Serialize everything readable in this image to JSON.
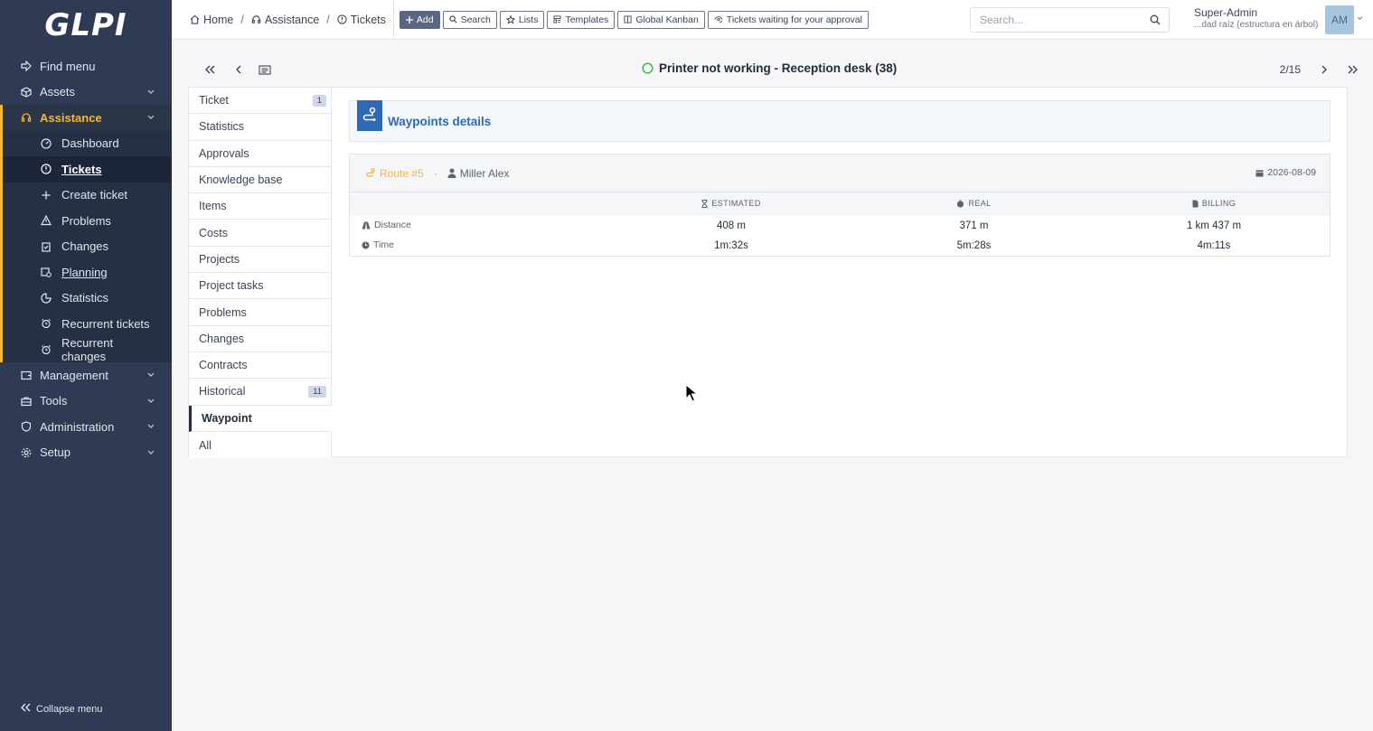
{
  "sidebar": {
    "logo": "GLPI",
    "items": [
      {
        "label": "Find menu",
        "icon": "arrow-right-icon"
      },
      {
        "label": "Assets",
        "icon": "box-icon"
      },
      {
        "label": "Assistance",
        "icon": "headset-icon"
      },
      {
        "label": "Management",
        "icon": "wallet-icon"
      },
      {
        "label": "Tools",
        "icon": "briefcase-icon"
      },
      {
        "label": "Administration",
        "icon": "shield-icon"
      },
      {
        "label": "Setup",
        "icon": "gear-icon"
      }
    ],
    "assistance_sub": [
      {
        "label": "Dashboard",
        "icon": "gauge-icon"
      },
      {
        "label": "Tickets",
        "icon": "alert-circle-icon"
      },
      {
        "label": "Create ticket",
        "icon": "plus-icon"
      },
      {
        "label": "Problems",
        "icon": "warning-icon"
      },
      {
        "label": "Changes",
        "icon": "clipboard-check-icon"
      },
      {
        "label": "Planning",
        "icon": "calendar-time-icon"
      },
      {
        "label": "Statistics",
        "icon": "chart-pie-icon"
      },
      {
        "label": "Recurrent tickets",
        "icon": "alarm-icon"
      },
      {
        "label": "Recurrent changes",
        "icon": "alarm-icon"
      }
    ],
    "collapse_label": "Collapse menu",
    "accent_color": "#f5b63c",
    "bg_color": "#2f3b54"
  },
  "topbar": {
    "breadcrumbs": [
      {
        "label": "Home",
        "icon": "home-icon"
      },
      {
        "label": "Assistance",
        "icon": "headset-icon"
      },
      {
        "label": "Tickets",
        "icon": "alert-circle-icon"
      }
    ],
    "actions": [
      {
        "label": "Add",
        "icon": "plus-icon"
      },
      {
        "label": "Search",
        "icon": "search-icon"
      },
      {
        "label": "Lists",
        "icon": "star-icon"
      },
      {
        "label": "Templates",
        "icon": "template-icon"
      },
      {
        "label": "Global Kanban",
        "icon": "columns-icon"
      },
      {
        "label": "Tickets waiting for your approval",
        "icon": "eye-check-icon"
      }
    ],
    "search_placeholder": "Search...",
    "user_name": "Super-Admin",
    "user_entity": "...dad raíz (estructura en árbol)",
    "avatar_initials": "AM"
  },
  "ticket": {
    "title": "Printer not working - Reception desk (38)",
    "status_color": "#2fb344",
    "counter": "2/15"
  },
  "tabs": [
    {
      "label": "Ticket",
      "badge": "1"
    },
    {
      "label": "Statistics",
      "badge": ""
    },
    {
      "label": "Approvals",
      "badge": ""
    },
    {
      "label": "Knowledge base",
      "badge": ""
    },
    {
      "label": "Items",
      "badge": ""
    },
    {
      "label": "Costs",
      "badge": ""
    },
    {
      "label": "Projects",
      "badge": ""
    },
    {
      "label": "Project tasks",
      "badge": ""
    },
    {
      "label": "Problems",
      "badge": ""
    },
    {
      "label": "Changes",
      "badge": ""
    },
    {
      "label": "Contracts",
      "badge": ""
    },
    {
      "label": "Historical",
      "badge": "11"
    },
    {
      "label": "Waypoint",
      "badge": ""
    },
    {
      "label": "All",
      "badge": ""
    }
  ],
  "waypoints": {
    "title": "Waypoints details",
    "route_label": "Route #5",
    "technician": "Miller Alex",
    "date": "2026-08-09",
    "columns": [
      "ESTIMATED",
      "REAL",
      "BILLING"
    ],
    "rows": [
      {
        "label": "Distance",
        "icon": "road-icon",
        "values": [
          "408 m",
          "371 m",
          "1 km 437 m"
        ]
      },
      {
        "label": "Time",
        "icon": "clock-icon",
        "values": [
          "1m:32s",
          "5m:28s",
          "4m:11s"
        ]
      }
    ]
  }
}
